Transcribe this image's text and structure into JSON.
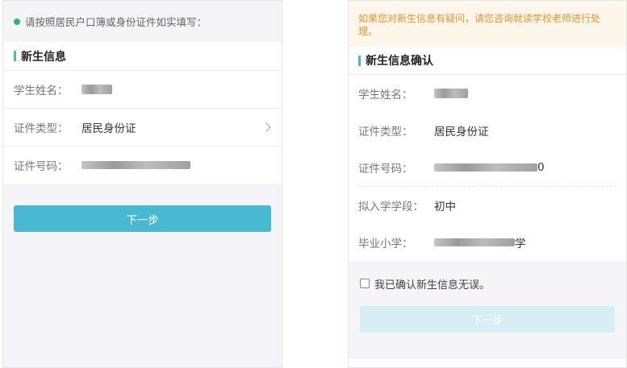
{
  "left": {
    "hint": "请按照居民户口簿或身份证件如实填写：",
    "section_title": "新生信息",
    "rows": [
      {
        "label": "学生姓名：",
        "value": ""
      },
      {
        "label": "证件类型：",
        "value": "居民身份证"
      },
      {
        "label": "证件号码：",
        "value": ""
      }
    ],
    "next_button": "下一步"
  },
  "right": {
    "notice": "如果您对新生信息有疑问，请您咨询就读学校老师进行处理。",
    "section_title": "新生信息确认",
    "rows": [
      {
        "label": "学生姓名：",
        "value": ""
      },
      {
        "label": "证件类型：",
        "value": "居民身份证"
      },
      {
        "label": "证件号码：",
        "value": "0"
      }
    ],
    "rows2": [
      {
        "label": "拟入学学段：",
        "value": "初中"
      },
      {
        "label": "毕业小学：",
        "value": "学"
      }
    ],
    "confirm_text": "我已确认新生信息无误。",
    "next_button": "下一步"
  },
  "colors": {
    "accent": "#48b9d0",
    "dot": "#2bb673",
    "notice_text": "#e5952f",
    "notice_bg": "#fdf6ea",
    "disabled_button": "#d7eef3"
  },
  "icons": {
    "hint_dot": "dot-icon",
    "chevron": "chevron-right-icon",
    "checkbox": "checkbox-icon"
  }
}
